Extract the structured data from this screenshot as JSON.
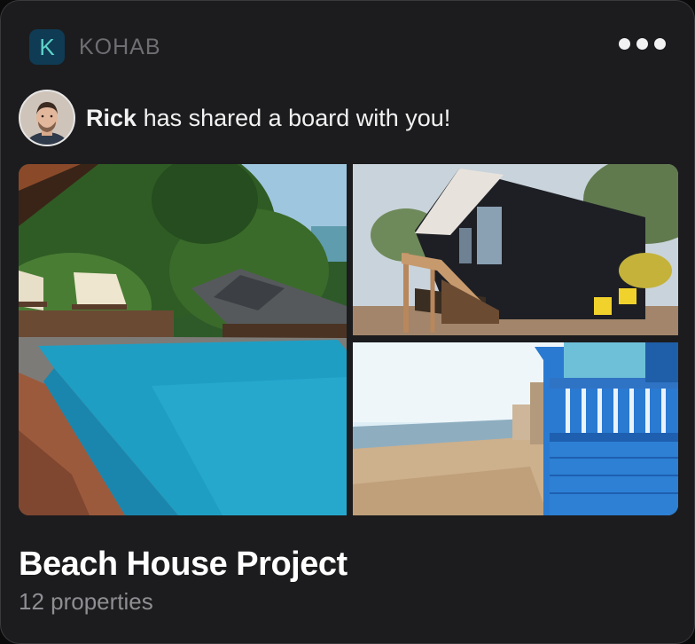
{
  "app": {
    "logo_letter": "K",
    "name": "KOHAB",
    "accent": "#5fd3c8",
    "logo_bg": "#0f3b55"
  },
  "menu": {
    "icon": "more-horizontal-icon"
  },
  "share": {
    "sender": "Rick",
    "message": "has shared a board with you!"
  },
  "gallery": {
    "photos": [
      {
        "name": "infinity pool photo"
      },
      {
        "name": "dark timber house photo"
      },
      {
        "name": "blue beach hut photo"
      }
    ]
  },
  "board": {
    "title": "Beach House Project",
    "subtitle": "12 properties"
  }
}
